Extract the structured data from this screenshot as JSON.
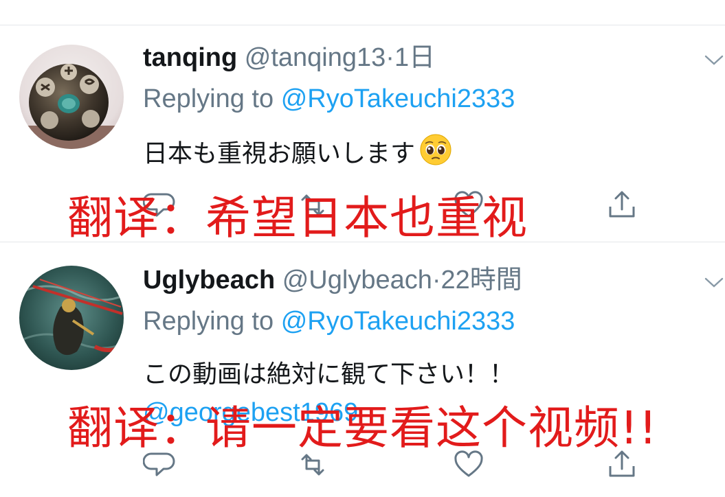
{
  "tweets": [
    {
      "name": "tanqing",
      "handle": "@tanqing13",
      "separator": "·",
      "time": "1日",
      "reply_prefix": "Replying to",
      "reply_target": "@RyoTakeuchi2333",
      "text": "日本も重視お願いします",
      "emoji": "pleading-face",
      "avatar": "dice-photo",
      "overlay": "翻译：希望日本也重视"
    },
    {
      "name": "Uglybeach",
      "handle": "@Uglybeach",
      "separator": "·",
      "time": "22時間",
      "reply_prefix": "Replying to",
      "reply_target": "@RyoTakeuchi2333",
      "text": "この動画は絶対に観て下さい！！",
      "mention": "@georgebest1969",
      "avatar": "painted-figure",
      "overlay": "翻译：请一定要看这个视频!!"
    }
  ],
  "icons": {
    "reply": "reply-icon",
    "retweet": "retweet-icon",
    "like": "like-icon",
    "share": "share-icon",
    "menu": "chevron-down-icon"
  },
  "colors": {
    "text": "#14171a",
    "muted": "#657786",
    "link": "#1da1f2",
    "overlay": "#e21b1b",
    "divider": "#e3e7ea"
  }
}
